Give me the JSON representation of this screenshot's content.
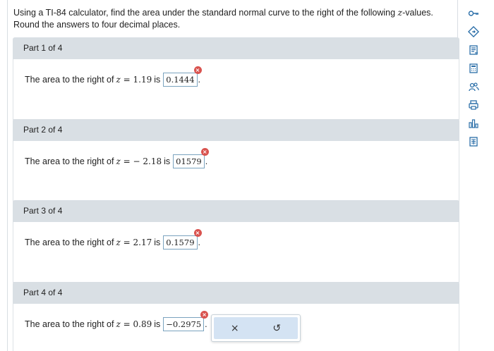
{
  "instructions": {
    "line1_pre": "Using a TI-84 calculator, find the area under the standard normal curve to the right of the following ",
    "z_symbol": "z",
    "line1_post": "-values.",
    "line2": "Round the answers to four decimal places."
  },
  "parts": [
    {
      "header": "Part 1 of 4",
      "question_pre": "The area to the right of",
      "z": "z",
      "eq": "=",
      "z_value": "1.19",
      "is_label": "is",
      "answer": "0.1444",
      "period": "."
    },
    {
      "header": "Part 2 of 4",
      "question_pre": "The area to the right of",
      "z": "z",
      "eq": "=",
      "z_value": "− 2.18",
      "is_label": "is",
      "answer": "01579",
      "period": "."
    },
    {
      "header": "Part 3 of 4",
      "question_pre": "The area to the right of",
      "z": "z",
      "eq": "=",
      "z_value": "2.17",
      "is_label": "is",
      "answer": "0.1579",
      "period": "."
    },
    {
      "header": "Part 4 of 4",
      "question_pre": "The area to the right of",
      "z": "z",
      "eq": "=",
      "z_value": "0.89",
      "is_label": "is",
      "answer": "−0.2975",
      "period": "."
    }
  ],
  "error_symbol": "×",
  "toolbar": {
    "icons": [
      "key-icon",
      "hint-icon",
      "notes-icon",
      "calculator-icon",
      "people-icon",
      "print-icon",
      "stats-icon",
      "data-table-icon"
    ]
  },
  "popup": {
    "clear_symbol": "×",
    "undo_symbol": "↺"
  },
  "colors": {
    "accent": "#2a6ea8",
    "error": "#d9534f",
    "header_bg": "#d9dfe4",
    "popup_bg": "#d4e3f3"
  }
}
